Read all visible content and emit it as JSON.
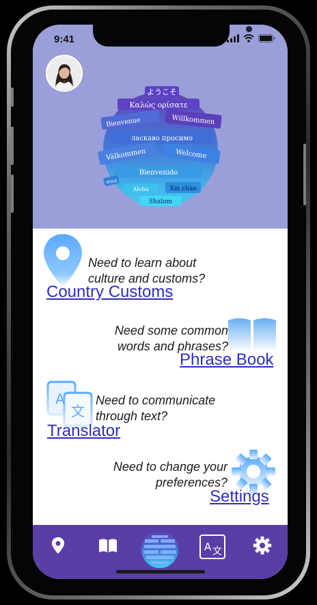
{
  "status_bar": {
    "time": "9:41"
  },
  "hero": {
    "greetings": [
      "ようこそ",
      "Καλώς ορίσατε",
      "Bienvenue",
      "Willkommen",
      "ласкаво просимо",
      "Välkommen",
      "Welcome",
      "Bienvenido",
      "Xin chào",
      "Shalom",
      "Aloha",
      "Witaj"
    ]
  },
  "sections": {
    "customs": {
      "question": "Need to learn about culture and customs?",
      "link": "Country Customs"
    },
    "phrases": {
      "question": "Need some common words and phrases?",
      "link": "Phrase Book"
    },
    "translator": {
      "question": "Need to communicate through text?",
      "link": "Translator"
    },
    "settings": {
      "question": "Need to change your preferences?",
      "link": "Settings"
    }
  },
  "colors": {
    "header_bg": "#9a9fd9",
    "nav_bg": "#5a3ea7",
    "link": "#2c2fc0",
    "icon_blue": "#5aa9ff"
  },
  "icons": [
    "location-pin-icon",
    "open-book-icon",
    "globe-logo",
    "translate-icon",
    "gear-icon"
  ]
}
